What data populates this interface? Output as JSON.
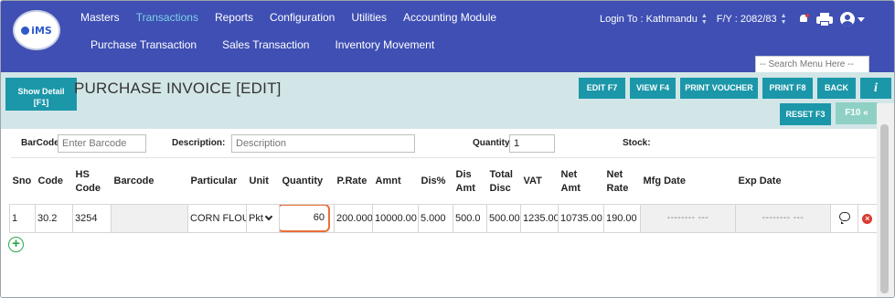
{
  "brand": {
    "logo_text": "iMS"
  },
  "nav": {
    "menu": [
      "Masters",
      "Transactions",
      "Reports",
      "Configuration",
      "Utilities",
      "Accounting Module"
    ],
    "active_menu": "Transactions",
    "submenu": [
      "Purchase Transaction",
      "Sales Transaction",
      "Inventory Movement"
    ]
  },
  "topright": {
    "login_label": "Login To :",
    "location": "Kathmandu",
    "fy_label": "F/Y :",
    "fy_value": "2082/83"
  },
  "search_menu": {
    "placeholder": "-- Search Menu Here --"
  },
  "header": {
    "show_detail": "Show Detail",
    "show_detail_key": "[F1]",
    "title": "PURCHASE INVOICE [EDIT]",
    "buttons": {
      "edit": "EDIT F7",
      "view": "VIEW F4",
      "print_voucher": "PRINT VOUCHER",
      "print": "PRINT F8",
      "back": "BACK",
      "info": "i",
      "reset": "RESET F3",
      "f10": "F10 «"
    }
  },
  "filters": {
    "barcode_label": "BarCode",
    "barcode_placeholder": "Enter Barcode",
    "description_label": "Description:",
    "description_placeholder": "Description",
    "quantity_label": "Quantity",
    "quantity_value": "1",
    "stock_label": "Stock:"
  },
  "table": {
    "headers": {
      "sno": "Sno",
      "code": "Code",
      "hs1": "HS",
      "hs2": "Code",
      "barcode": "Barcode",
      "particular": "Particular",
      "unit": "Unit",
      "quantity": "Quantity",
      "prate": "P.Rate",
      "amnt": "Amnt",
      "dis": "Dis%",
      "disamt1": "Dis",
      "disamt2": "Amt",
      "totaldisc1": "Total",
      "totaldisc2": "Disc",
      "vat": "VAT",
      "netamt1": "Net",
      "netamt2": "Amt",
      "netrate1": "Net",
      "netrate2": "Rate",
      "mfg": "Mfg Date",
      "exp": "Exp Date"
    },
    "rows": [
      {
        "sno": "1",
        "code": "30.2",
        "hs": "3254",
        "barcode": "",
        "particular": "CORN FLOU",
        "unit": "Pkt",
        "quantity": "60",
        "prate": "200.000",
        "amnt": "10000.00",
        "dis": "5.000",
        "disamt": "500.0",
        "totaldisc": "500.00",
        "vat": "1235.00",
        "netamt": "10735.00",
        "netrate": "190.00",
        "mfg": "-------- ---",
        "exp": "-------- ---"
      }
    ]
  },
  "colors": {
    "nav": "#3f4fb3",
    "accent": "#1b97a9",
    "header_band": "#d2e6e8",
    "highlight": "#e8703a"
  }
}
